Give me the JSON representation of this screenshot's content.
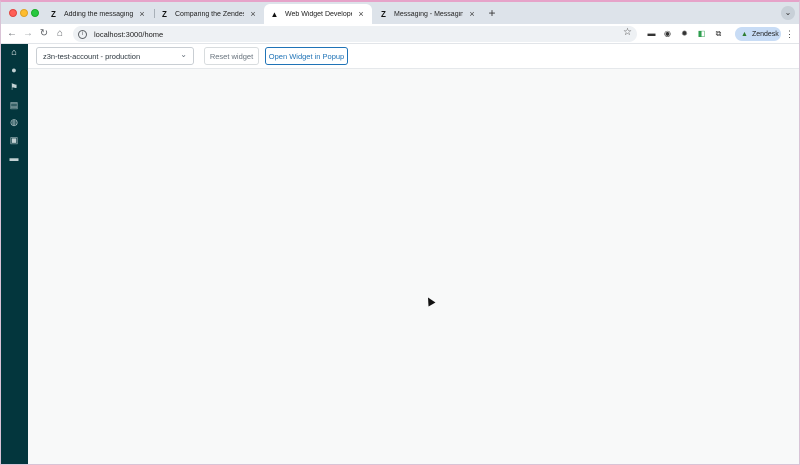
{
  "browser": {
    "tabs": [
      {
        "title": "Adding the messaging Web W",
        "favicon": "zendesk-logo-icon",
        "active": false
      },
      {
        "title": "Comparing the Zendesk Web",
        "favicon": "zendesk-logo-icon",
        "active": false
      },
      {
        "title": "Web Widget Developer Dashb",
        "favicon": "triangle-logo-icon",
        "active": true
      },
      {
        "title": "Messaging - Messaging and",
        "favicon": "zendesk-logo-icon",
        "active": false
      }
    ],
    "url": "localhost:3000/home",
    "profile_name": "Zendesk"
  },
  "app": {
    "account_select_value": "z3n-test-account - production",
    "reset_button_label": "Reset widget",
    "popup_button_label": "Open Widget in Popup",
    "sidebar_icons": [
      "home-icon",
      "user-icon",
      "flag-icon",
      "book-icon",
      "globe-icon",
      "lock-icon",
      "chat-icon"
    ]
  },
  "colors": {
    "sidebar_bg": "#03363d",
    "accent_blue": "#1f73b7",
    "tabstrip_bg": "#dde3ea"
  }
}
